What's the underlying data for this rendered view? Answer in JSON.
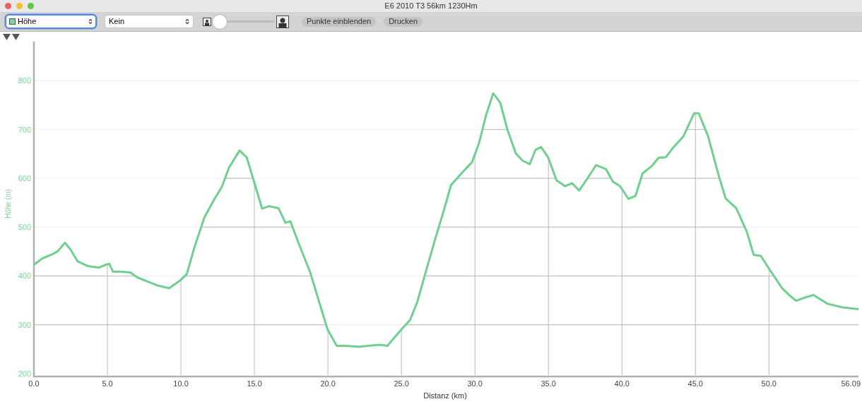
{
  "window": {
    "title": "E6 2010 T3 56km 1230Hm"
  },
  "toolbar": {
    "series_select": {
      "value": "Höhe",
      "color": "#7dd49a",
      "focused": true
    },
    "compare_select": {
      "value": "Kein",
      "focused": false
    },
    "zoom_slider": {
      "level": 0.0
    },
    "buttons": [
      "Punkte einblenden",
      "Drucken"
    ]
  },
  "chart": {
    "chart_data": {
      "type": "line",
      "xlabel": "Distanz (km)",
      "ylabel": "Höhe (m)",
      "x": [
        0,
        0.57,
        1.29,
        1.63,
        2.11,
        2.49,
        2.97,
        3.69,
        4.41,
        4.89,
        5.13,
        5.37,
        5.85,
        6.56,
        7.04,
        7.76,
        8.48,
        9.2,
        9.92,
        10.4,
        10.88,
        11.6,
        12.31,
        12.79,
        13.27,
        13.99,
        14.47,
        14.95,
        15.52,
        16.0,
        16.63,
        17.11,
        17.44,
        18.07,
        18.78,
        19.36,
        19.98,
        20.6,
        21.18,
        22.14,
        23.1,
        23.57,
        24.05,
        24.44,
        25.01,
        25.59,
        26.07,
        26.69,
        27.31,
        27.89,
        28.37,
        29.08,
        29.8,
        30.28,
        30.76,
        31.24,
        31.72,
        32.2,
        32.78,
        33.25,
        33.73,
        34.12,
        34.5,
        34.98,
        35.55,
        36.13,
        36.61,
        37.09,
        37.57,
        38.24,
        38.91,
        39.39,
        39.87,
        40.44,
        40.92,
        41.4,
        42.02,
        42.5,
        42.98,
        43.46,
        44.18,
        44.9,
        45.23,
        45.86,
        46.57,
        47.05,
        47.77,
        48.49,
        48.96,
        49.45,
        49.98,
        50.89,
        51.37,
        51.85,
        52.56,
        53.04,
        54.0,
        54.96,
        56.09
      ],
      "series": [
        {
          "color": "#6fcf8f",
          "values": [
            423,
            436,
            445,
            451,
            468,
            454,
            430,
            420,
            417,
            423,
            425,
            409,
            409,
            407,
            397,
            388,
            380,
            375,
            390,
            404,
            455,
            520,
            559,
            583,
            622,
            657,
            643,
            596,
            538,
            543,
            539,
            509,
            512,
            462,
            409,
            351,
            290,
            257,
            257,
            255,
            258,
            259,
            257,
            271,
            291,
            310,
            346,
            412,
            477,
            535,
            586,
            610,
            633,
            672,
            730,
            774,
            755,
            701,
            651,
            636,
            629,
            658,
            664,
            643,
            596,
            584,
            590,
            575,
            596,
            627,
            619,
            593,
            584,
            558,
            564,
            610,
            625,
            642,
            643,
            662,
            686,
            733,
            733,
            686,
            607,
            559,
            539,
            491,
            443,
            441,
            416,
            375,
            361,
            349,
            357,
            361,
            343,
            336,
            332
          ]
        }
      ],
      "xlim": [
        0,
        56.09
      ],
      "ylim": [
        197,
        880
      ],
      "grid": true,
      "xticks": [
        {
          "value": 0,
          "label": "0.0"
        },
        {
          "value": 5,
          "label": "5.0"
        },
        {
          "value": 10,
          "label": "10.0"
        },
        {
          "value": 15,
          "label": "15.0"
        },
        {
          "value": 20,
          "label": "20.0"
        },
        {
          "value": 25,
          "label": "25.0"
        },
        {
          "value": 30,
          "label": "30.0"
        },
        {
          "value": 35,
          "label": "35.0"
        },
        {
          "value": 40,
          "label": "40.0"
        },
        {
          "value": 45,
          "label": "45.0"
        },
        {
          "value": 50,
          "label": "50.0"
        },
        {
          "value": 56.09,
          "label": "56.09"
        }
      ],
      "yticks": [
        200,
        300,
        400,
        500,
        600,
        700,
        800
      ]
    }
  }
}
